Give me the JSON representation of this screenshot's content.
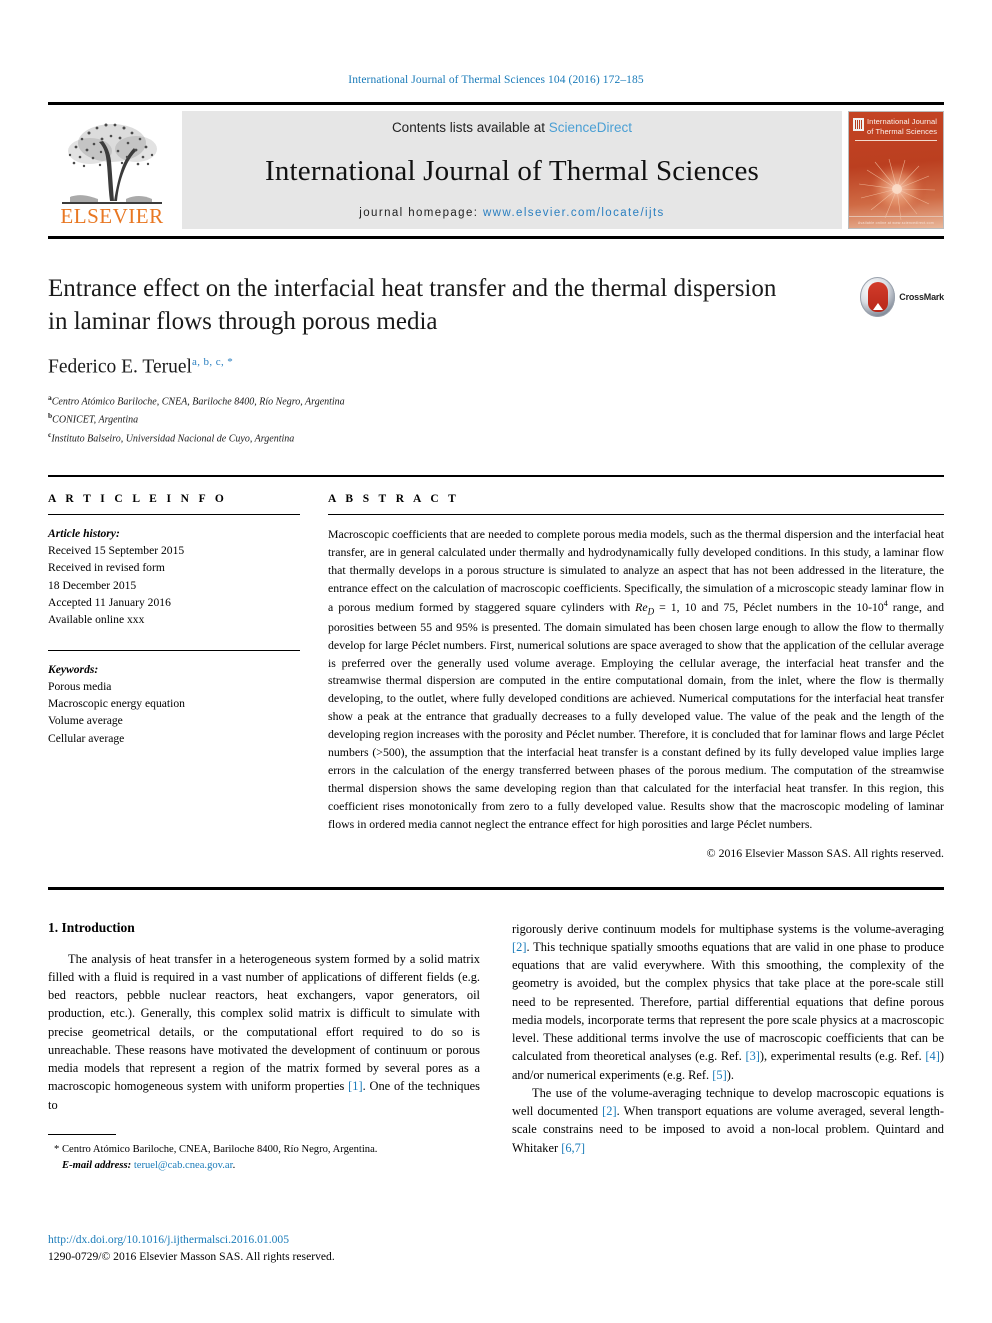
{
  "running_head": "International Journal of Thermal Sciences 104 (2016) 172–185",
  "banner": {
    "contents_prefix": "Contents lists available at ",
    "sciencedirect": "ScienceDirect",
    "journal_title": "International Journal of Thermal Sciences",
    "homepage_prefix": "journal homepage: ",
    "homepage_url": "www.elsevier.com/locate/ijts",
    "publisher": "ELSEVIER",
    "cover_title": "International Journal of Thermal Sciences",
    "cover_footer": "Available online at www.sciencedirect.com",
    "accent_blue": "#2a7fc0",
    "elsevier_orange": "#e87722",
    "cover_red": "#c44424"
  },
  "article": {
    "title": "Entrance effect on the interfacial heat transfer and the thermal dispersion in laminar flows through porous media",
    "author": "Federico E. Teruel",
    "author_affil_marks": "a, b, c, *",
    "affiliations": [
      {
        "mark": "a",
        "text": "Centro Atómico Bariloche, CNEA, Bariloche 8400, Río Negro, Argentina"
      },
      {
        "mark": "b",
        "text": "CONICET, Argentina"
      },
      {
        "mark": "c",
        "text": "Instituto Balseiro, Universidad Nacional de Cuyo, Argentina"
      }
    ],
    "crossmark_label": "CrossMark"
  },
  "info": {
    "heading": "A R T I C L E   I N F O",
    "history_label": "Article history:",
    "history": [
      "Received 15 September 2015",
      "Received in revised form",
      "18 December 2015",
      "Accepted 11 January 2016",
      "Available online xxx"
    ],
    "keywords_label": "Keywords:",
    "keywords": [
      "Porous media",
      "Macroscopic energy equation",
      "Volume average",
      "Cellular average"
    ]
  },
  "abstract": {
    "heading": "A B S T R A C T",
    "p1_a": "Macroscopic coefficients that are needed to complete porous media models, such as the thermal dispersion and the interfacial heat transfer, are in general calculated under thermally and hydrodynamically fully developed conditions. In this study, a laminar flow that thermally develops in a porous structure is simulated to analyze an aspect that has not been addressed in the literature, the entrance effect on the calculation of macroscopic coefficients. Specifically, the simulation of a microscopic steady laminar flow in a porous medium formed by staggered square cylinders with ",
    "re_symbol": "Re",
    "re_sub": "D",
    "p1_b": " = 1, 10 and 75, Péclet numbers in the 10-10",
    "pe_exp": "4",
    "p1_c": " range, and porosities between 55 and 95% is presented. The domain simulated has been chosen large enough to allow the flow to thermally develop for large Péclet numbers. First, numerical solutions are space averaged to show that the application of the cellular average is preferred over the generally used volume average. Employing the cellular average, the interfacial heat transfer and the streamwise thermal dispersion are computed in the entire computational domain, from the inlet, where the flow is thermally developing, to the outlet, where fully developed conditions are achieved. Numerical computations for the interfacial heat transfer show a peak at the entrance that gradually decreases to a fully developed value. The value of the peak and the length of the developing region increases with the porosity and Péclet number. Therefore, it is concluded that for laminar flows and large Péclet numbers (>500), the assumption that the interfacial heat transfer is a constant defined by its fully developed value implies large errors in the calculation of the energy transferred between phases of the porous medium. The computation of the streamwise thermal dispersion shows the same developing region than that calculated for the interfacial heat transfer. In this region, this coefficient rises monotonically from zero to a fully developed value. Results show that the macroscopic modeling of laminar flows in ordered media cannot neglect the entrance effect for high porosities and large Péclet numbers.",
    "copyright": "© 2016 Elsevier Masson SAS. All rights reserved."
  },
  "introduction": {
    "heading": "1. Introduction",
    "left_p1_a": "The analysis of heat transfer in a heterogeneous system formed by a solid matrix filled with a fluid is required in a vast number of applications of different fields (e.g. bed reactors, pebble nuclear reactors, heat exchangers, vapor generators, oil production, etc.). Generally, this complex solid matrix is difficult to simulate with precise geometrical details, or the computational effort required to do so is unreachable. These reasons have motivated the development of continuum or porous media models that represent a region of the matrix formed by several pores as a macroscopic homogeneous system with uniform properties ",
    "ref1": "[1]",
    "left_p1_b": ". One of the techniques to",
    "right_p1_a": "rigorously derive continuum models for multiphase systems is the volume-averaging ",
    "ref2": "[2]",
    "right_p1_b": ". This technique spatially smooths equations that are valid in one phase to produce equations that are valid everywhere. With this smoothing, the complexity of the geometry is avoided, but the complex physics that take place at the pore-scale still need to be represented. Therefore, partial differential equations that define porous media models, incorporate terms that represent the pore scale physics at a macroscopic level. These additional terms involve the use of macroscopic coefficients that can be calculated from theoretical analyses (e.g. Ref. ",
    "ref3": "[3]",
    "right_p1_c": "), experimental results (e.g. Ref. ",
    "ref4": "[4]",
    "right_p1_d": ") and/or numerical experiments (e.g. Ref. ",
    "ref5": "[5]",
    "right_p1_e": ").",
    "right_p2_a": "The use of the volume-averaging technique to develop macroscopic equations is well documented ",
    "ref2b": "[2]",
    "right_p2_b": ". When transport equations are volume averaged, several length-scale constrains need to be imposed to avoid a non-local problem. Quintard and Whitaker ",
    "ref67": "[6,7]"
  },
  "footnote": {
    "marker": "*",
    "address": "Centro Atómico Bariloche, CNEA, Bariloche 8400, Río Negro, Argentina.",
    "email_label": "E-mail address:",
    "email": "teruel@cab.cnea.gov.ar"
  },
  "pagefooter": {
    "doi": "http://dx.doi.org/10.1016/j.ijthermalsci.2016.01.005",
    "issn_line": "1290-0729/© 2016 Elsevier Masson SAS. All rights reserved."
  }
}
